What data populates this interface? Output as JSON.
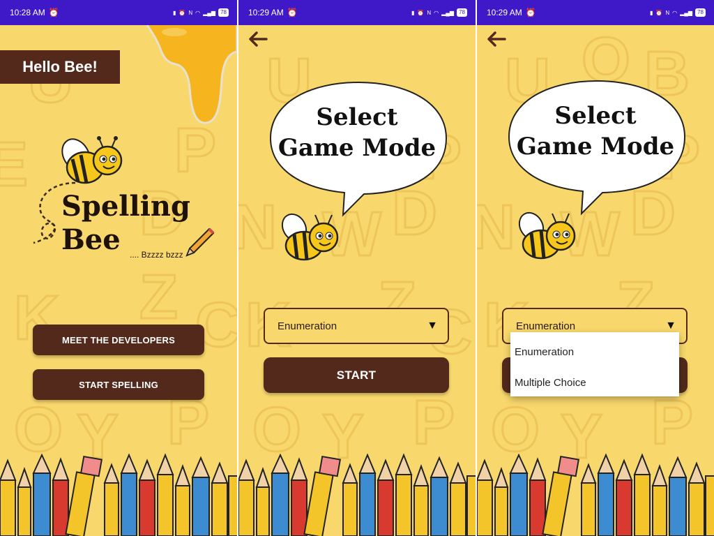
{
  "status_bars": [
    {
      "time": "10:28 AM",
      "battery": "78"
    },
    {
      "time": "10:29 AM",
      "battery": "78"
    },
    {
      "time": "10:29 AM",
      "battery": "78"
    }
  ],
  "home": {
    "greeting": "Hello Bee!",
    "title_line1": "Spelling",
    "title_line2": "Bee",
    "tagline": ".... Bzzzz bzzz",
    "meet_button": "MEET THE DEVELOPERS",
    "start_spelling_button": "START SPELLING"
  },
  "mode_select": {
    "bubble_line1": "Select",
    "bubble_line2": "Game Mode",
    "selected_mode": "Enumeration",
    "start_button": "START"
  },
  "mode_dropdown": {
    "bubble_line1": "Select",
    "bubble_line2": "Game Mode",
    "selected_mode": "Enumeration",
    "options": [
      "Enumeration",
      "Multiple Choice"
    ]
  },
  "colors": {
    "background": "#f8d86c",
    "status_bar": "#3f19c8",
    "button": "#53291c"
  },
  "icons": {
    "back": "arrow-left-icon",
    "caret": "triangle-down-icon",
    "mascot": "bee-icon"
  }
}
